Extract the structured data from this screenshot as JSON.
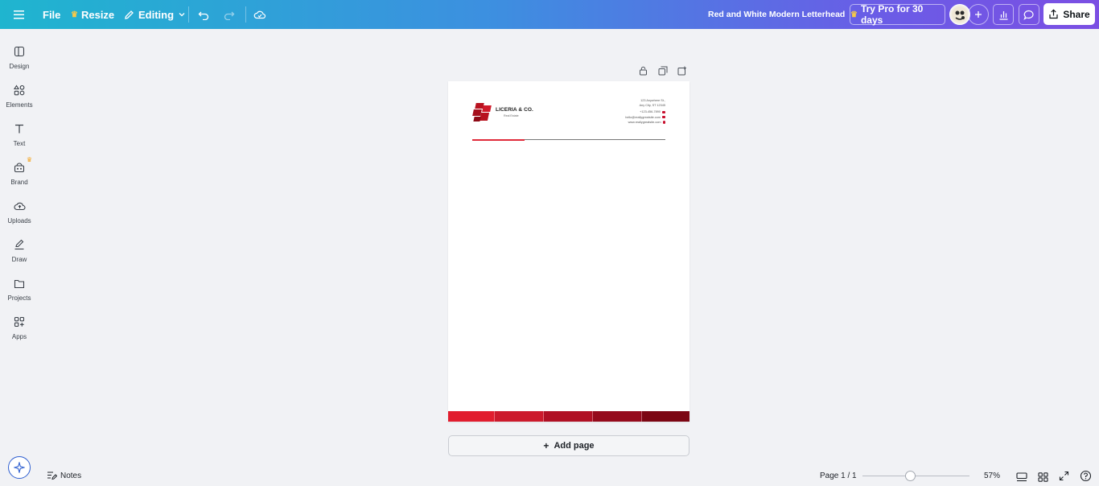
{
  "topbar": {
    "file_label": "File",
    "resize_label": "Resize",
    "editing_label": "Editing",
    "doc_title": "Red and White Modern Letterhead",
    "pro_label": "Try Pro for 30 days",
    "share_label": "Share"
  },
  "sidebar": {
    "items": [
      {
        "label": "Design",
        "icon": "design-icon"
      },
      {
        "label": "Elements",
        "icon": "elements-icon"
      },
      {
        "label": "Text",
        "icon": "text-icon"
      },
      {
        "label": "Brand",
        "icon": "brand-icon"
      },
      {
        "label": "Uploads",
        "icon": "uploads-icon"
      },
      {
        "label": "Draw",
        "icon": "draw-icon"
      },
      {
        "label": "Projects",
        "icon": "projects-icon"
      },
      {
        "label": "Apps",
        "icon": "apps-icon"
      }
    ]
  },
  "letterhead": {
    "company_name": "LICERIA & CO.",
    "tagline": "Real Estate",
    "address_1": "123 Anywhere St.,",
    "address_2": "Any City, ST 12345",
    "phone": "+123-456-7890",
    "email": "hello@reallygreatsite.com",
    "website": "www.reallygreatsite.com",
    "brand_color": "#b8121f",
    "footer_colors": [
      "#e11d2e",
      "#cc1a2c",
      "#b01024",
      "#950a1c",
      "#7c0613"
    ]
  },
  "canvas": {
    "add_page_label": "Add page"
  },
  "bottombar": {
    "notes_label": "Notes",
    "page_indicator": "Page 1 / 1",
    "zoom_label": "57%",
    "zoom_value": 0.57
  }
}
